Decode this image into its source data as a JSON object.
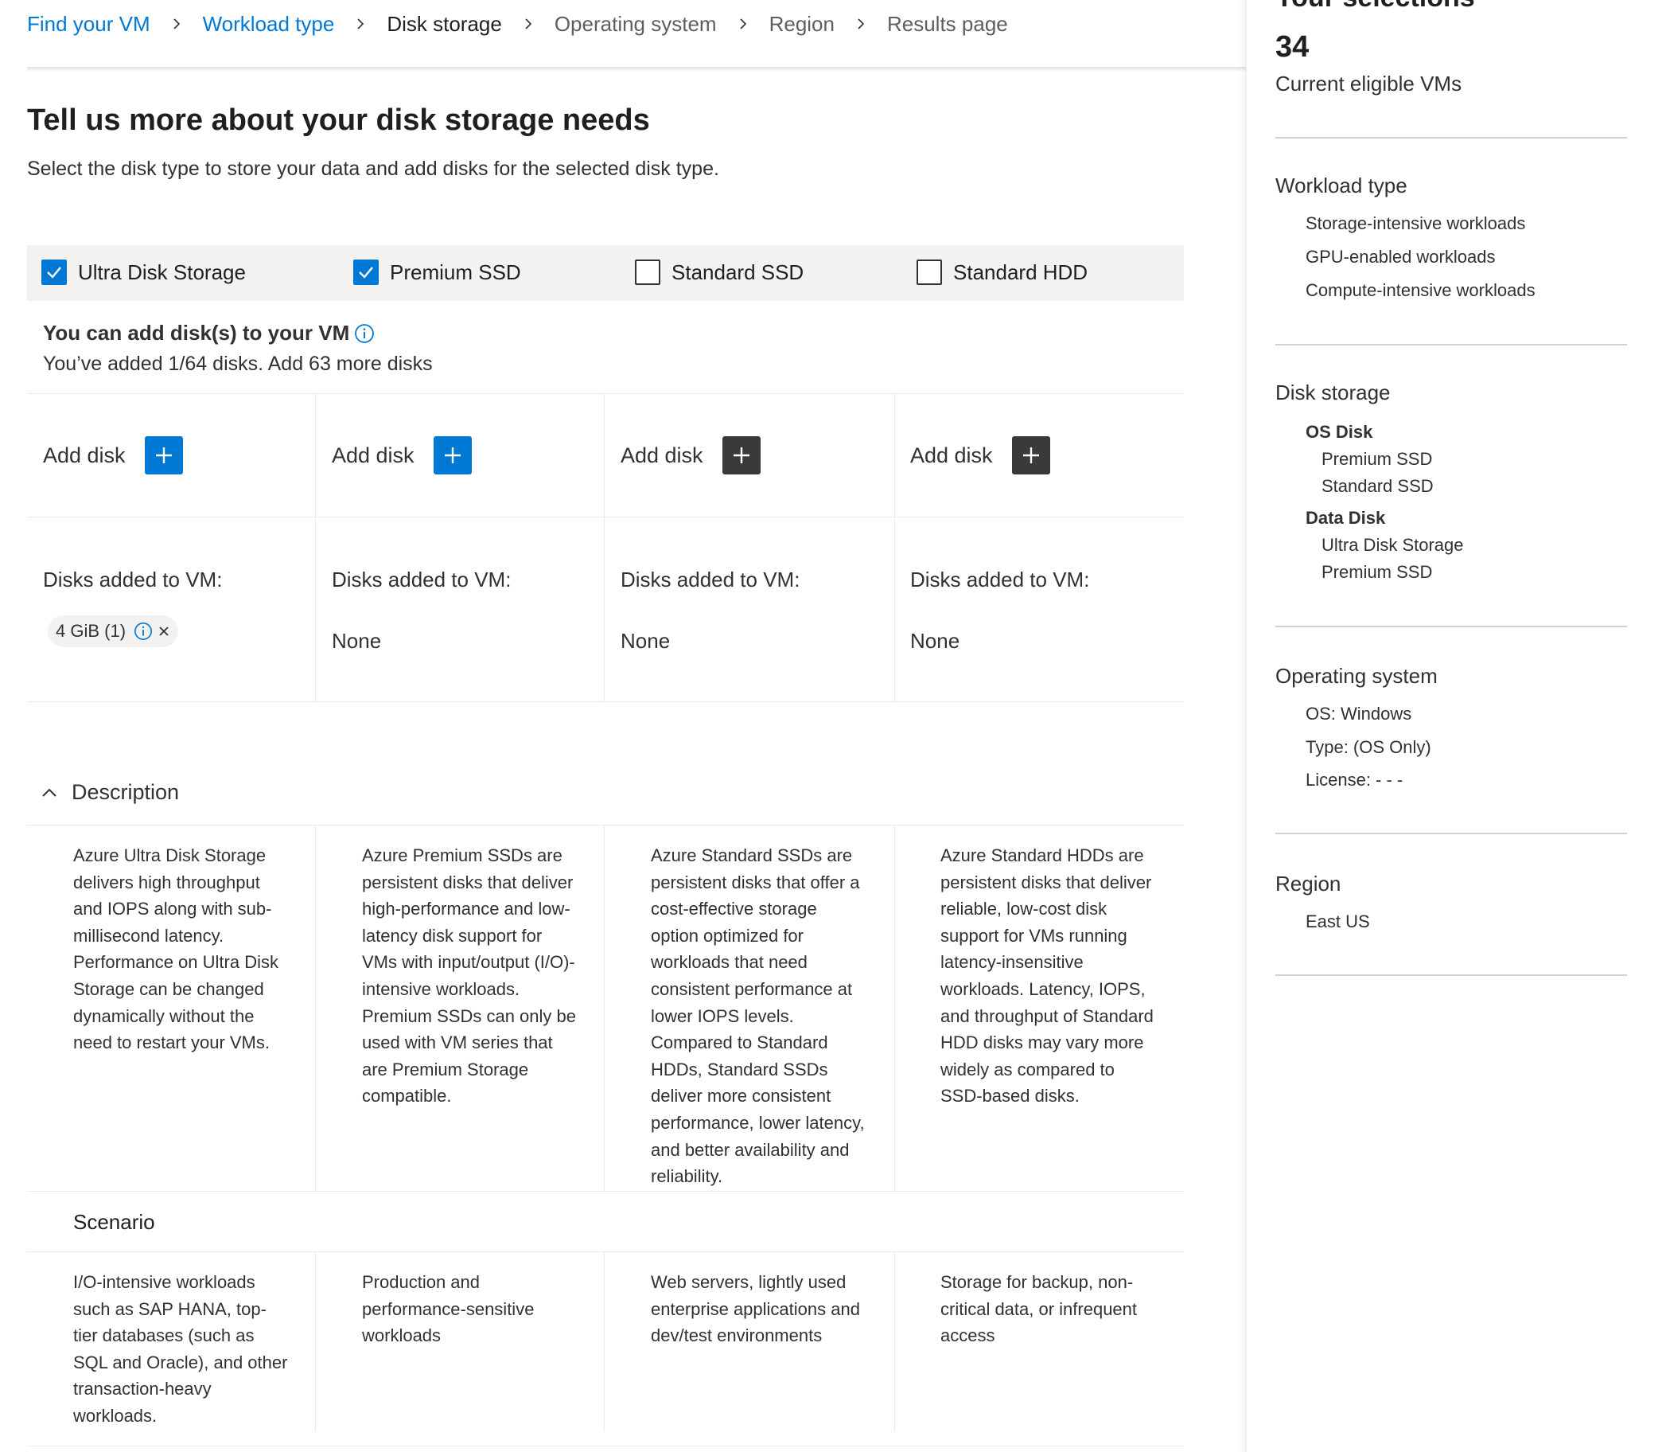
{
  "breadcrumb": {
    "items": [
      {
        "label": "Find your VM",
        "state": "link"
      },
      {
        "label": "Workload type",
        "state": "link"
      },
      {
        "label": "Disk storage",
        "state": "current"
      },
      {
        "label": "Operating system",
        "state": "future"
      },
      {
        "label": "Region",
        "state": "future"
      },
      {
        "label": "Results page",
        "state": "future"
      }
    ]
  },
  "page": {
    "title": "Tell us more about your disk storage needs",
    "subtitle": "Select the disk type to store your data and add disks for the selected disk type."
  },
  "disk_types": [
    {
      "label": "Ultra Disk Storage",
      "checked": true
    },
    {
      "label": "Premium SSD",
      "checked": true
    },
    {
      "label": "Standard SSD",
      "checked": false
    },
    {
      "label": "Standard HDD",
      "checked": false
    }
  ],
  "add_section": {
    "title": "You can add disk(s) to your VM",
    "subtitle": "You’ve added 1/64 disks. Add 63 more disks"
  },
  "columns": [
    {
      "add_label": "Add disk",
      "button_style": "blue",
      "disks_label": "Disks added to VM:",
      "chip": "4 GiB (1)",
      "description": "Azure Ultra Disk Storage delivers high throughput and IOPS along with sub-millisecond latency. Performance on Ultra Disk Storage can be changed dynamically without the need to restart your VMs.",
      "scenario": "I/O-intensive workloads such as SAP HANA, top-tier databases (such as SQL and Oracle), and other transaction-heavy workloads."
    },
    {
      "add_label": "Add disk",
      "button_style": "blue",
      "disks_label": "Disks added to VM:",
      "none_label": "None",
      "description": "Azure Premium SSDs are persistent disks that deliver high-performance and low-latency disk support for VMs with input/output (I/O)-intensive workloads. Premium SSDs can only be used with VM series that are Premium Storage compatible.",
      "scenario": "Production and performance-sensitive workloads"
    },
    {
      "add_label": "Add disk",
      "button_style": "dark",
      "disks_label": "Disks added to VM:",
      "none_label": "None",
      "description": "Azure Standard SSDs are persistent disks that offer a cost-effective storage option optimized for workloads that need consistent performance at lower IOPS levels. Compared to Standard HDDs, Standard SSDs deliver more consistent performance, lower latency, and better availability and reliability.",
      "scenario": "Web servers, lightly used enterprise applications and dev/test environments"
    },
    {
      "add_label": "Add disk",
      "button_style": "dark",
      "disks_label": "Disks added to VM:",
      "none_label": "None",
      "description": "Azure Standard HDDs are persistent disks that deliver reliable, low-cost disk support for VMs running latency-insensitive workloads. Latency, IOPS, and throughput of Standard HDD disks may vary more widely as compared to SSD-based disks.",
      "scenario": "Storage for backup, non-critical data, or infrequent access"
    }
  ],
  "description_section": {
    "title": "Description",
    "expanded": true
  },
  "scenario_section": {
    "title": "Scenario"
  },
  "sidebar": {
    "heading": "Your selections",
    "count": "34",
    "count_label": "Current eligible VMs",
    "workload": {
      "title": "Workload type",
      "items": [
        "Storage-intensive workloads",
        "GPU-enabled workloads",
        "Compute-intensive workloads"
      ]
    },
    "disk": {
      "title": "Disk storage",
      "os_title": "OS Disk",
      "os_items": [
        "Premium SSD",
        "Standard SSD"
      ],
      "data_title": "Data Disk",
      "data_items": [
        "Ultra Disk Storage",
        "Premium SSD"
      ]
    },
    "os": {
      "title": "Operating system",
      "items": [
        "OS: Windows",
        "Type: (OS Only)",
        "License: - - -"
      ]
    },
    "region": {
      "title": "Region",
      "items": [
        "East US"
      ]
    }
  },
  "colors": {
    "accent": "#0078d4",
    "dark_button": "#3b3a39",
    "bar_bg": "#f3f2f1"
  }
}
